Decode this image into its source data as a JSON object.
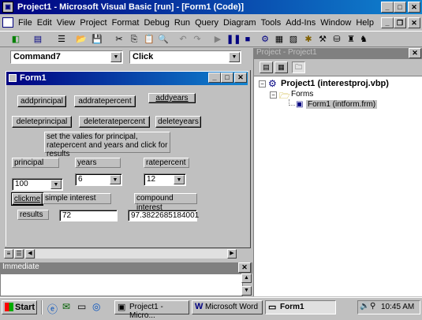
{
  "app": {
    "title": "Project1 - Microsoft Visual Basic [run] - [Form1 (Code)]"
  },
  "menu": [
    "File",
    "Edit",
    "View",
    "Project",
    "Format",
    "Debug",
    "Run",
    "Query",
    "Diagram",
    "Tools",
    "Add-Ins",
    "Window",
    "Help"
  ],
  "code": {
    "object_combo": "Command7",
    "proc_combo": "Click"
  },
  "form": {
    "title": "Form1",
    "buttons": {
      "addprincipal": "addprincipal",
      "addratepercent": "addratepercent",
      "addyears": "addyears",
      "deleteprincipal": "deleteprincipal",
      "deleteratepercent": "deleteratepercent",
      "deleteyears": "deleteyears",
      "clickme": "clickme"
    },
    "instructions": "set the valies for principal, ratepercent and years and click for results",
    "labels": {
      "principal": "principal",
      "years": "years",
      "ratepercent": "ratepercent",
      "simple_interest": "simple interest",
      "compound_interest": "compound interest",
      "results": "results"
    },
    "combos": {
      "principal": "100",
      "years": "6",
      "ratepercent": "12"
    },
    "results": {
      "simple": "72",
      "compound": "97.3822685184001"
    }
  },
  "project": {
    "title": "Project - Project1",
    "root": "Project1 (interestproj.vbp)",
    "folder": "Forms",
    "file": "Form1 (intform.frm)"
  },
  "immediate": {
    "title": "Immediate"
  },
  "taskbar": {
    "start": "Start",
    "tasks": [
      "Project1 - Micro...",
      "Microsoft Word",
      "Form1"
    ],
    "time": "10:45 AM"
  },
  "colors": {
    "title_active": "#000080",
    "desktop": "#c0c0c0"
  }
}
